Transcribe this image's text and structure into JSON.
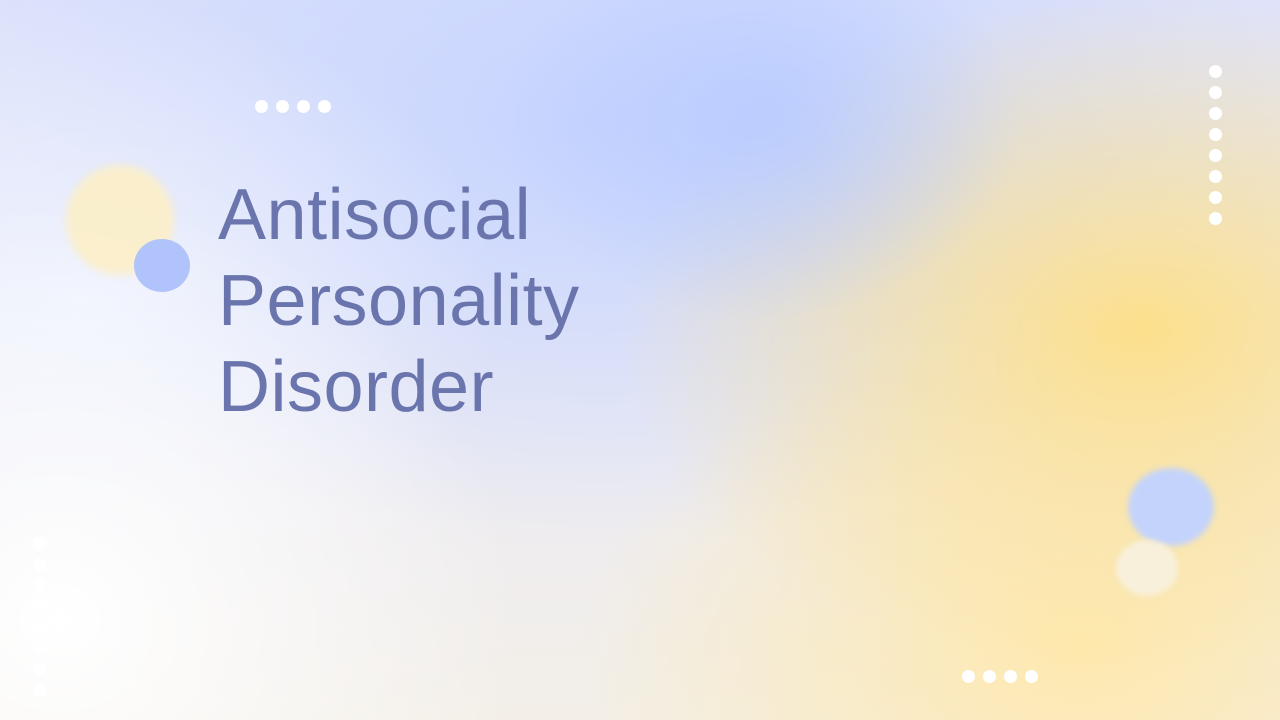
{
  "slide": {
    "title_lines": [
      "Antisocial",
      "Personality",
      "Disorder"
    ]
  },
  "colors": {
    "title": "#6a75ad",
    "accent_blue": "#b1c3fb",
    "accent_yellow": "#fde08c",
    "dots": "#ffffff"
  },
  "decorations": {
    "dot_groups": [
      {
        "name": "top-left-row",
        "count": 4
      },
      {
        "name": "right-column",
        "count": 8
      },
      {
        "name": "left-column",
        "count": 8
      },
      {
        "name": "bottom-right-row",
        "count": 4
      }
    ]
  }
}
